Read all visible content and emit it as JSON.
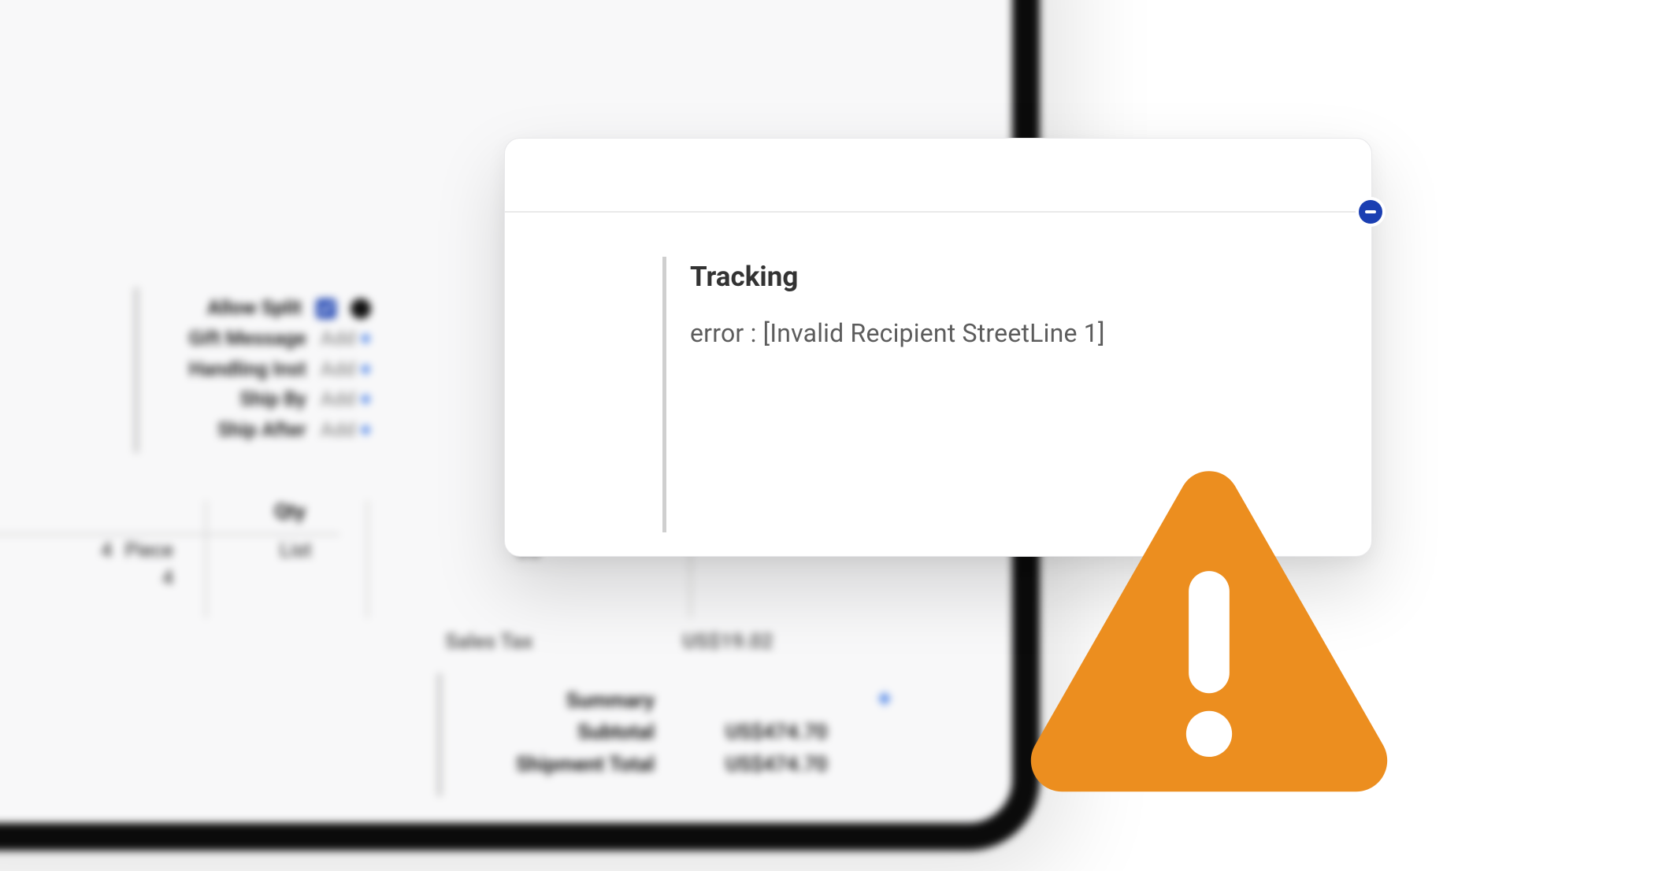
{
  "options": {
    "allow_split": {
      "label": "Allow Split",
      "checked": true,
      "help": true
    },
    "gift_message": {
      "label": "Gift Message",
      "add": "Add"
    },
    "handling_inst": {
      "label": "Handling Inst",
      "add": "Add"
    },
    "ship_by": {
      "label": "Ship By",
      "add": "Add"
    },
    "ship_after": {
      "label": "Ship After",
      "add": "Add"
    }
  },
  "line_items": {
    "qty_header": "Qty",
    "qty_value": "4",
    "unit_label": "Piece",
    "secondary_qty": "4",
    "price_type": "List",
    "currency_prefix": "US"
  },
  "totals": {
    "sales_tax_label": "Sales Tax",
    "sales_tax_value": "US$19.02",
    "summary_label": "Summary",
    "subtotal_label": "Subtotal",
    "subtotal_value": "US$474.70",
    "shipment_total_label": "Shipment Total",
    "shipment_total_value": "US$474.70"
  },
  "modal": {
    "title": "Tracking",
    "message": "error : [Invalid Recipient StreetLine 1]"
  },
  "colors": {
    "accent_blue": "#1b3fb2",
    "warning_orange": "#ec8e1f"
  }
}
